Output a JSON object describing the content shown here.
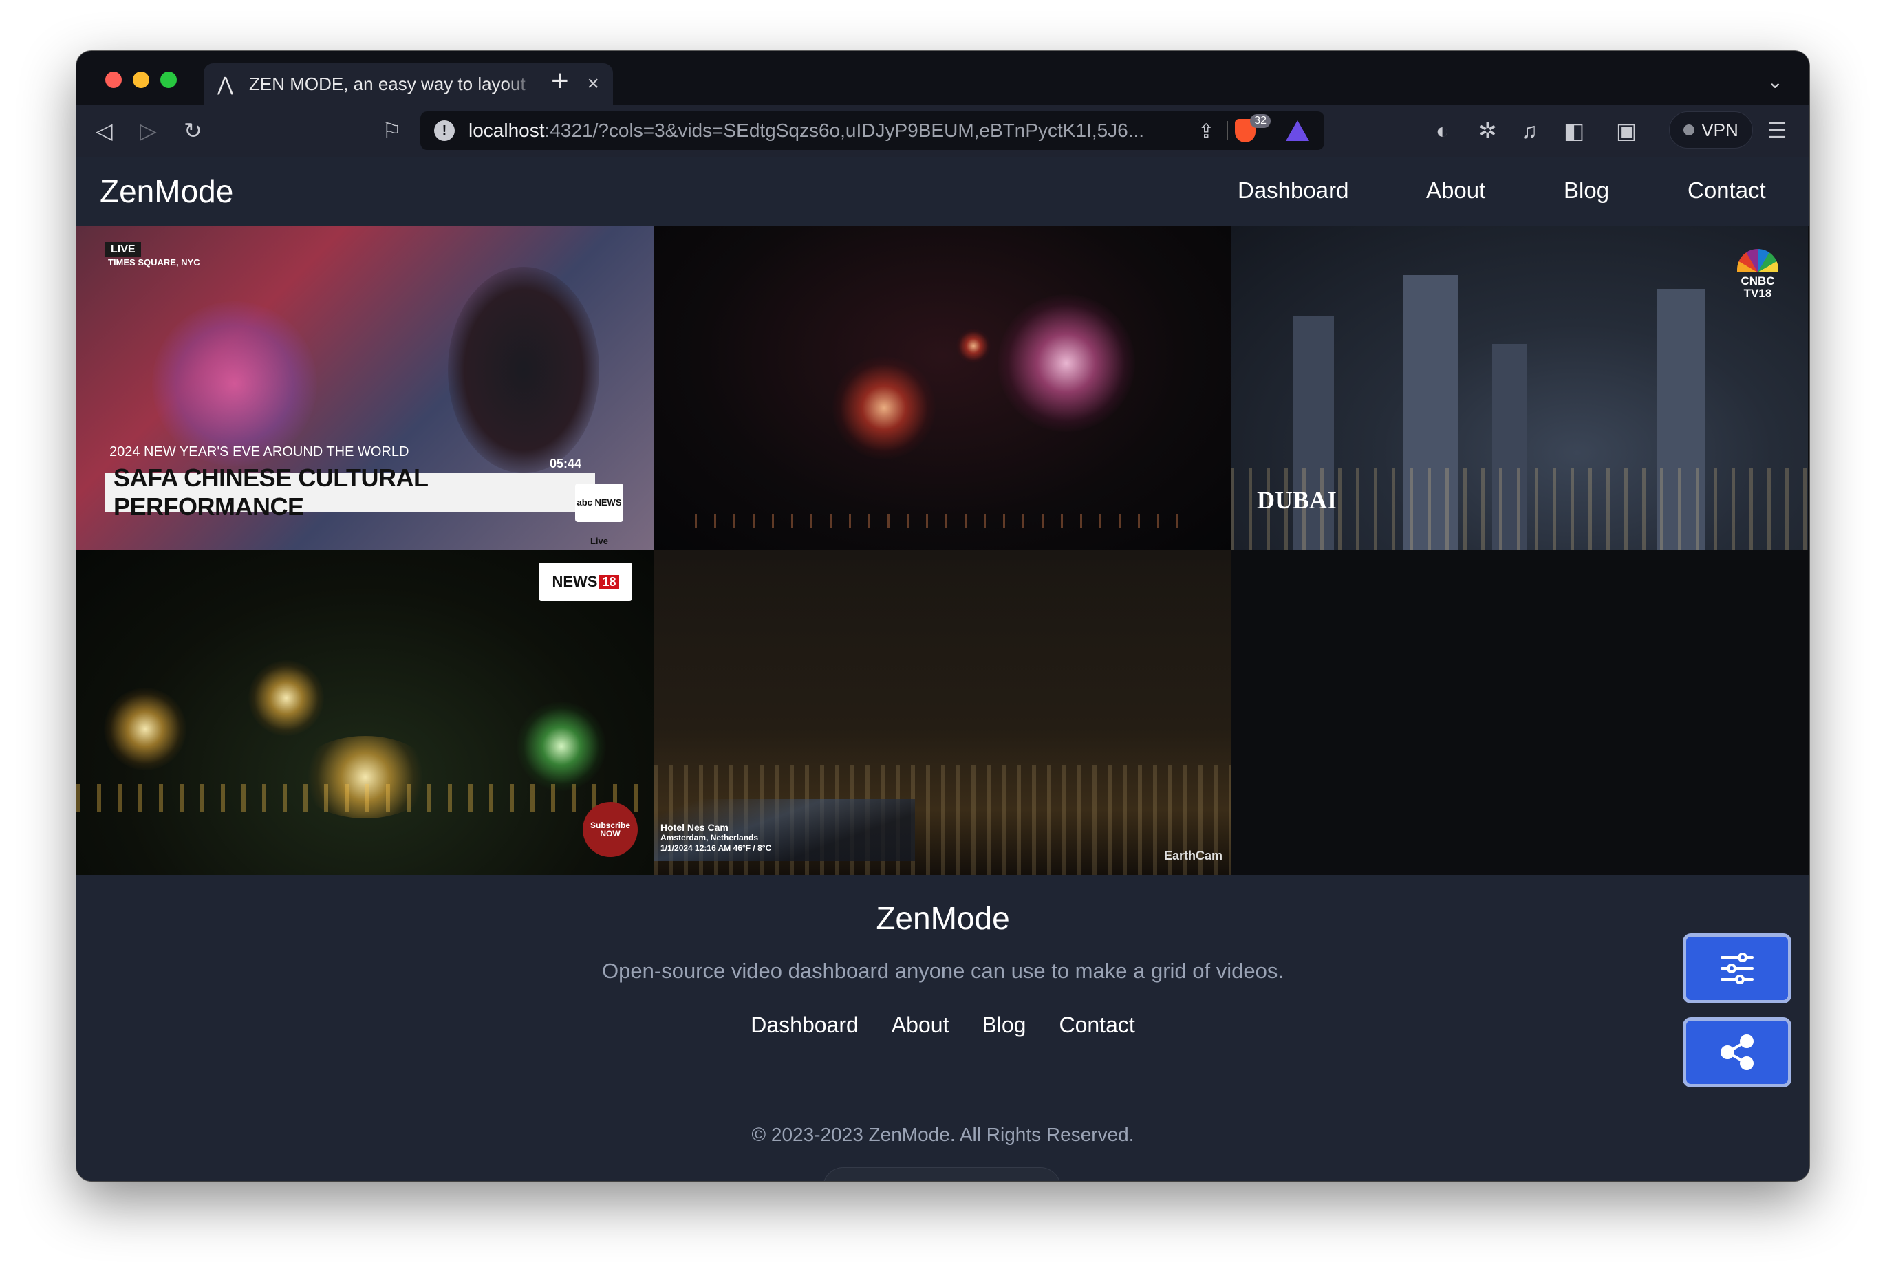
{
  "browser": {
    "tab_title": "ZEN MODE, an easy way to layout",
    "tab_close_icon": "×",
    "new_tab_icon": "+",
    "url_host": "localhost",
    "url_path": ":4321/?cols=3&vids=SEdtgSqzs6o,uIDJyP9BEUM,eBTnPyctK1I,5J6...",
    "shield_count": "32",
    "vpn_label": "VPN"
  },
  "nav": {
    "brand": "ZenMode",
    "links": [
      "Dashboard",
      "About",
      "Blog",
      "Contact"
    ]
  },
  "videos": {
    "v1": {
      "live": "LIVE",
      "location": "TIMES SQUARE, NYC",
      "overline": "2024 NEW YEAR'S EVE AROUND THE WORLD",
      "headline": "SAFA CHINESE CULTURAL PERFORMANCE",
      "time": "05:44",
      "network": "abc NEWS Live"
    },
    "v3": {
      "caption": "DUBAI",
      "network": "CNBC TV18"
    },
    "v4": {
      "network": "NEWS",
      "network_num": "18",
      "subscribe": "Subscribe NOW"
    },
    "v5": {
      "cam_title": "Hotel Nes Cam",
      "cam_location": "Amsterdam, Netherlands",
      "cam_meta": "1/1/2024   12:16 AM   46°F / 8°C",
      "network": "EarthCam"
    }
  },
  "footer": {
    "brand": "ZenMode",
    "tagline": "Open-source video dashboard anyone can use to make a grid of videos.",
    "links": [
      "Dashboard",
      "About",
      "Blog",
      "Contact"
    ],
    "copyright": "© 2023-2023 ZenMode. All Rights Reserved."
  },
  "colors": {
    "page_bg": "#1f2533",
    "fab_bg": "#2f5ee0"
  }
}
